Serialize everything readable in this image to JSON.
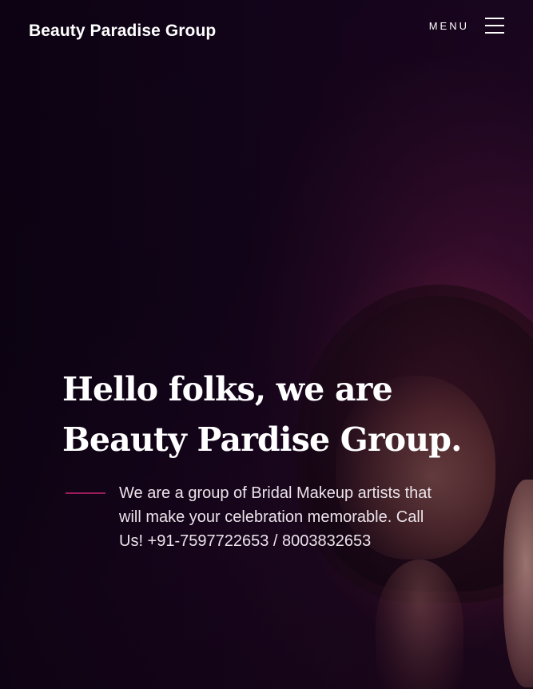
{
  "header": {
    "brand": "Beauty Paradise Group",
    "menu_label": "MENU",
    "menu_icon": "hamburger-icon"
  },
  "hero": {
    "title": "Hello folks, we are Beauty Pardise Group.",
    "description": "We are a group of Bridal Makeup artists that will make your celebration memorable. Call Us! +91-7597722653 / 8003832653",
    "background_image": "bride-with-mirror-photo"
  },
  "colors": {
    "accent": "#9b1c5a",
    "background": "#12061a",
    "text": "#ffffff"
  }
}
